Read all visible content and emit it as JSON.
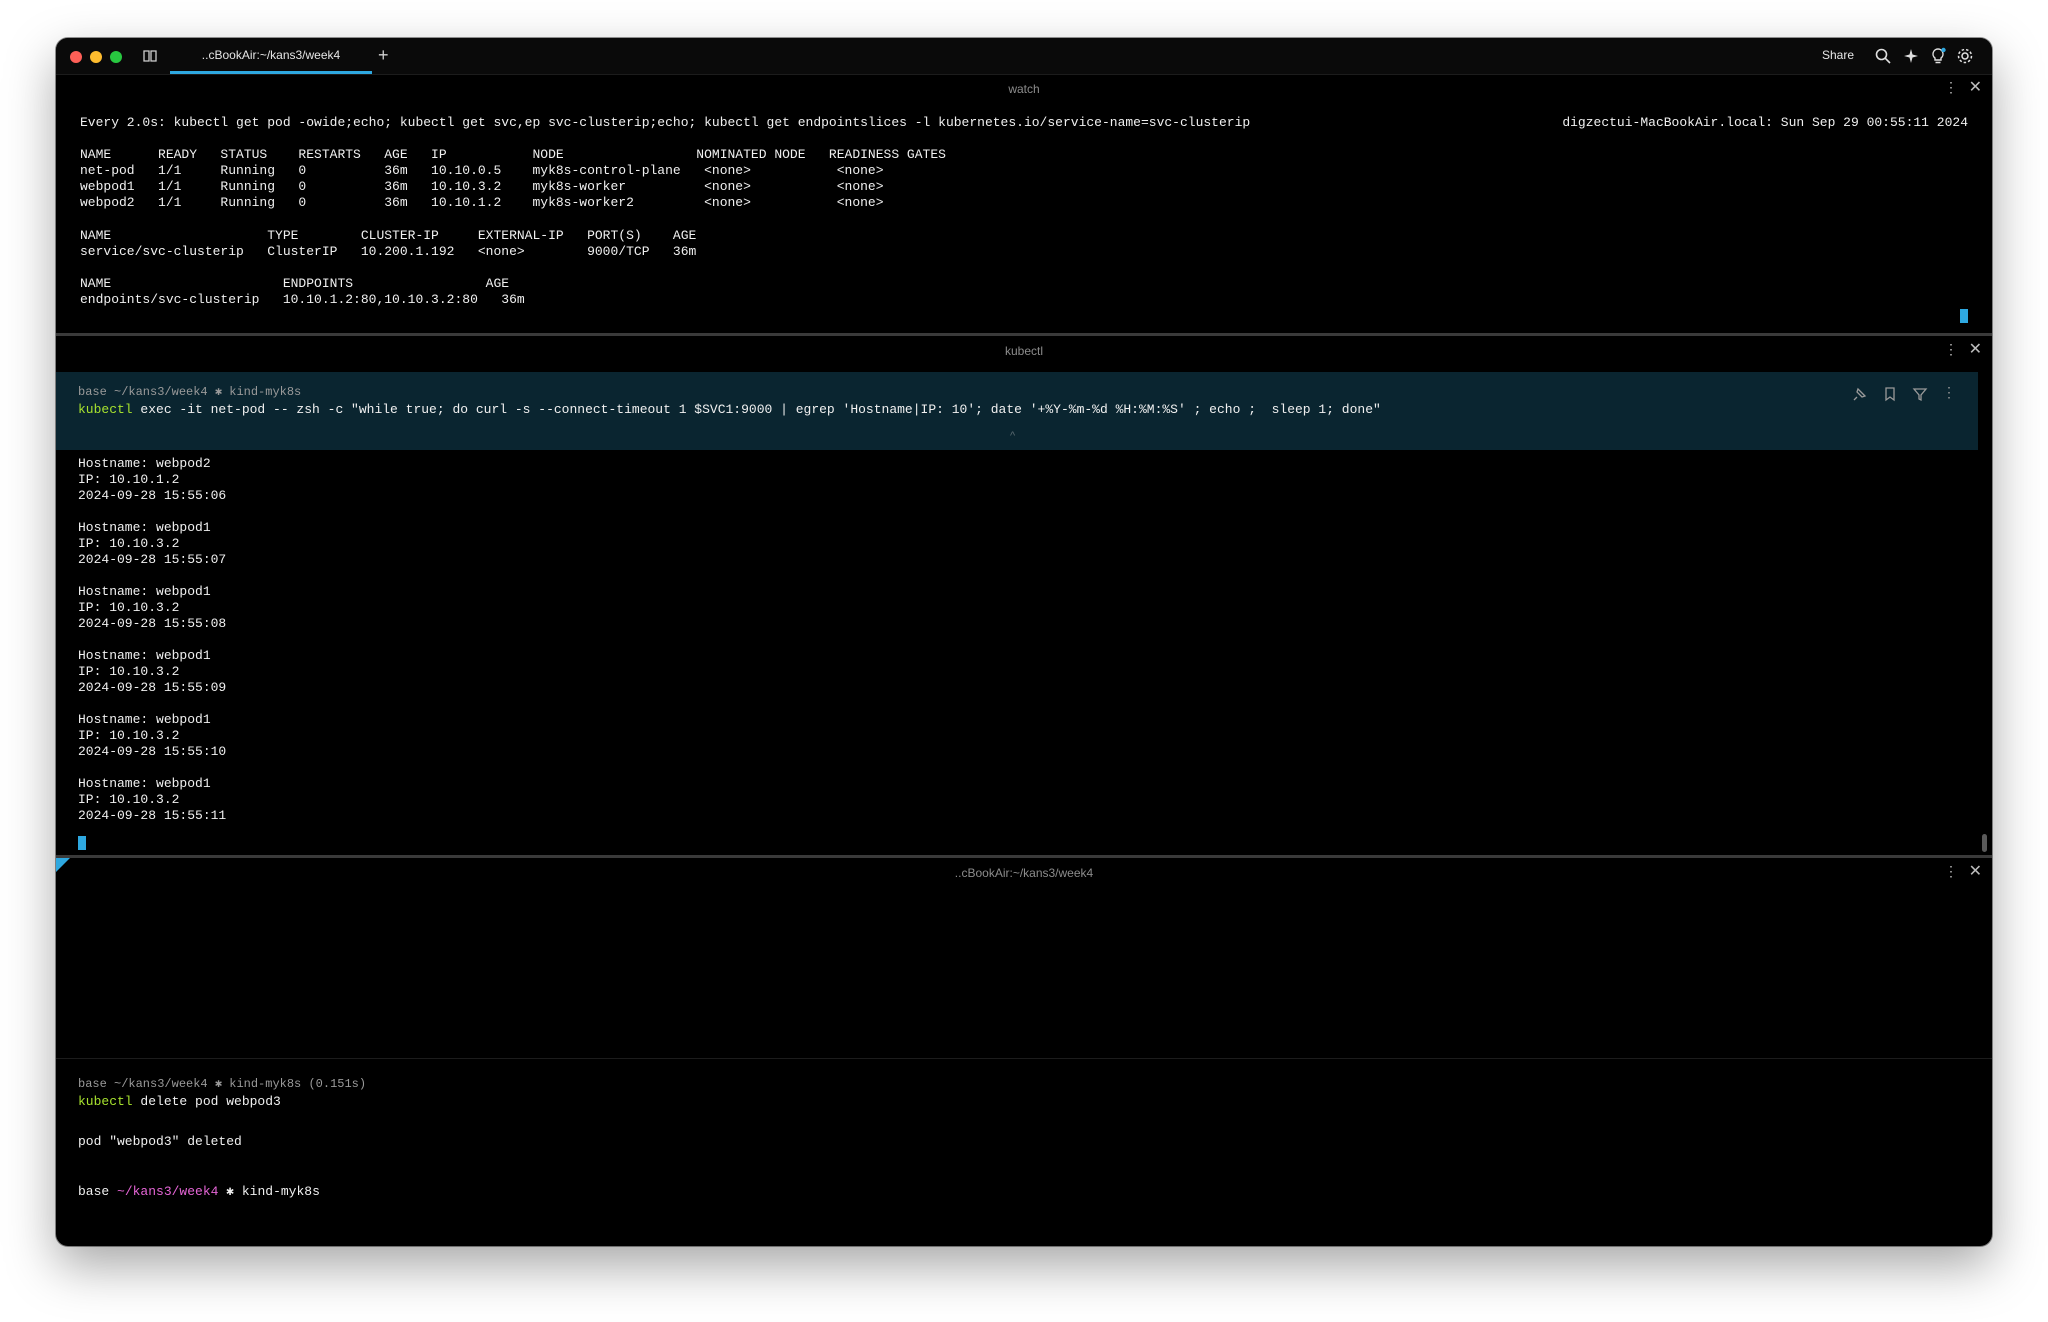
{
  "window": {
    "tab_label": "..cBookAir:~/kans3/week4",
    "share_label": "Share"
  },
  "pane1": {
    "title": "watch",
    "header_left": "Every 2.0s: kubectl get pod -owide;echo; kubectl get svc,ep svc-clusterip;echo; kubectl get endpointslices -l kubernetes.io/service-name=svc-clusterip",
    "header_right": "digzectui-MacBookAir.local: Sun Sep 29 00:55:11 2024",
    "pods_header": "NAME      READY   STATUS    RESTARTS   AGE   IP           NODE                 NOMINATED NODE   READINESS GATES",
    "pods_rows": [
      "net-pod   1/1     Running   0          36m   10.10.0.5    myk8s-control-plane   <none>           <none>",
      "webpod1   1/1     Running   0          36m   10.10.3.2    myk8s-worker          <none>           <none>",
      "webpod2   1/1     Running   0          36m   10.10.1.2    myk8s-worker2         <none>           <none>"
    ],
    "svc_header": "NAME                    TYPE        CLUSTER-IP     EXTERNAL-IP   PORT(S)    AGE",
    "svc_row": "service/svc-clusterip   ClusterIP   10.200.1.192   <none>        9000/TCP   36m",
    "ep_header": "NAME                      ENDPOINTS                 AGE",
    "ep_row": "endpoints/svc-clusterip   10.10.1.2:80,10.10.3.2:80   36m"
  },
  "pane2": {
    "title": "kubectl",
    "prompt": "base ~/kans3/week4 ✱ kind-myk8s",
    "command_name": "kubectl",
    "command_args": " exec -it net-pod -- zsh -c \"while true; do curl -s --connect-timeout 1 $SVC1:9000 | egrep 'Hostname|IP: 10'; date '+%Y-%m-%d %H:%M:%S' ; echo ;  sleep 1; done\"",
    "output": [
      {
        "hostname": "Hostname: webpod2",
        "ip": "IP: 10.10.1.2",
        "date": "2024-09-28 15:55:06"
      },
      {
        "hostname": "Hostname: webpod1",
        "ip": "IP: 10.10.3.2",
        "date": "2024-09-28 15:55:07"
      },
      {
        "hostname": "Hostname: webpod1",
        "ip": "IP: 10.10.3.2",
        "date": "2024-09-28 15:55:08"
      },
      {
        "hostname": "Hostname: webpod1",
        "ip": "IP: 10.10.3.2",
        "date": "2024-09-28 15:55:09"
      },
      {
        "hostname": "Hostname: webpod1",
        "ip": "IP: 10.10.3.2",
        "date": "2024-09-28 15:55:10"
      },
      {
        "hostname": "Hostname: webpod1",
        "ip": "IP: 10.10.3.2",
        "date": "2024-09-28 15:55:11"
      }
    ]
  },
  "pane3": {
    "title": "..cBookAir:~/kans3/week4",
    "prompt": "base ~/kans3/week4 ✱ kind-myk8s (0.151s)",
    "command_name": "kubectl",
    "command_args": " delete pod webpod3",
    "output": "pod \"webpod3\" deleted",
    "final_prompt_base": "base ",
    "final_prompt_path": "~/kans3/week4",
    "final_prompt_ctx": " ✱ kind-myk8s"
  },
  "colors": {
    "accent": "#2ea8e0",
    "command_green": "#a7e22e",
    "path_purple": "#e565d6",
    "block_bg": "#0a2530"
  }
}
